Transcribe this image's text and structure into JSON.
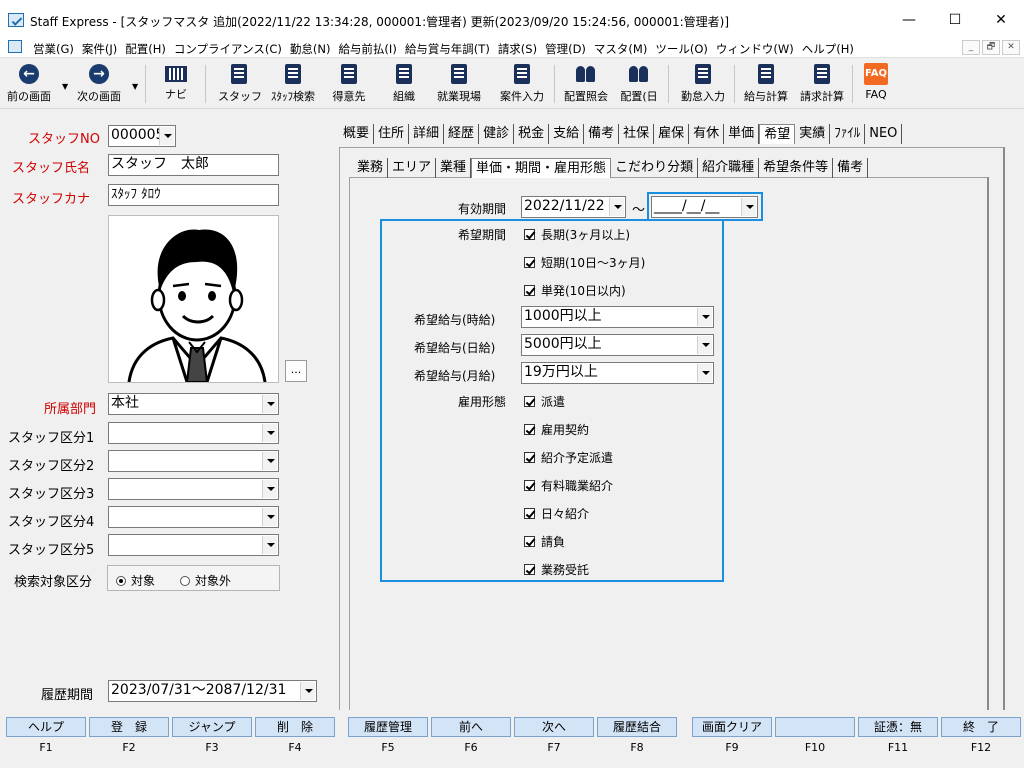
{
  "window": {
    "title": "Staff Express - [スタッフマスタ 追加(2022/11/22 13:34:28, 000001:管理者) 更新(2023/09/20 15:24:56, 000001:管理者)]",
    "min": "—",
    "max": "☐",
    "close": "✕"
  },
  "menu": [
    "営業(G)",
    "案件(J)",
    "配置(H)",
    "コンプライアンス(C)",
    "勤怠(N)",
    "給与前払(I)",
    "給与賞与年調(T)",
    "請求(S)",
    "管理(D)",
    "マスタ(M)",
    "ツール(O)",
    "ウィンドウ(W)",
    "ヘルプ(H)"
  ],
  "mdi": [
    "_",
    "🗗",
    "✕"
  ],
  "toolbar": {
    "prev": "前の画面",
    "next": "次の画面",
    "navi": "ナビ",
    "staff": "スタッフ",
    "staff_search": "ｽﾀｯﾌ検索",
    "client": "得意先",
    "org": "組織",
    "site": "就業現場",
    "job_entry": "案件入力",
    "assign_view": "配置照会",
    "assign_day": "配置(日",
    "attendance": "勤怠入力",
    "payroll": "給与計算",
    "billing": "請求計算",
    "faq": "FAQ"
  },
  "staff": {
    "no_label": "スタッフNO",
    "no_value": "000005",
    "name_label": "スタッフ氏名",
    "name_value": "スタッフ　太郎",
    "kana_label": "スタッフカナ",
    "kana_value": "ｽﾀｯﾌ ﾀﾛｳ",
    "browse": "...",
    "dept_label": "所属部門",
    "dept_value": "本社",
    "cat1": "スタッフ区分1",
    "cat2": "スタッフ区分2",
    "cat3": "スタッフ区分3",
    "cat4": "スタッフ区分4",
    "cat5": "スタッフ区分5",
    "search_label": "検索対象区分",
    "search_on": "対象",
    "search_off": "対象外",
    "history_label": "履歴期間",
    "history_value": "2023/07/31～2087/12/31"
  },
  "tabs": [
    "概要",
    "住所",
    "詳細",
    "経歴",
    "健診",
    "税金",
    "支給",
    "備考",
    "社保",
    "雇保",
    "有休",
    "単価",
    "希望",
    "実績",
    "ﾌｧｲﾙ",
    "NEO"
  ],
  "active_tab": "希望",
  "subtabs": [
    "業務",
    "エリア",
    "業種",
    "単価・期間・雇用形態",
    "こだわり分類",
    "紹介職種",
    "希望条件等",
    "備考"
  ],
  "active_subtab": "単価・期間・雇用形態",
  "form": {
    "valid_label": "有効期間",
    "valid_from": "2022/11/22",
    "tilde": "～",
    "valid_to": "____/__/__",
    "period_label": "希望期間",
    "period_long": "長期(3ヶ月以上)",
    "period_short": "短期(10日～3ヶ月)",
    "period_single": "単発(10日以内)",
    "pay_hour_label": "希望給与(時給)",
    "pay_hour": "1000円以上",
    "pay_day_label": "希望給与(日給)",
    "pay_day": "5000円以上",
    "pay_month_label": "希望給与(月給)",
    "pay_month": "19万円以上",
    "emp_label": "雇用形態",
    "emp": [
      "派遣",
      "雇用契約",
      "紹介予定派遣",
      "有料職業紹介",
      "日々紹介",
      "請負",
      "業務受託"
    ]
  },
  "fkeys": [
    {
      "label": "ヘルプ",
      "key": "F1"
    },
    {
      "label": "登　録",
      "key": "F2"
    },
    {
      "label": "ジャンプ",
      "key": "F3"
    },
    {
      "label": "削　除",
      "key": "F4"
    },
    {
      "label": "履歴管理",
      "key": "F5"
    },
    {
      "label": "前へ",
      "key": "F6"
    },
    {
      "label": "次へ",
      "key": "F7"
    },
    {
      "label": "履歴結合",
      "key": "F8"
    },
    {
      "label": "画面クリア",
      "key": "F9"
    },
    {
      "label": "",
      "key": "F10"
    },
    {
      "label": "証憑：無",
      "key": "F11"
    },
    {
      "label": "終　了",
      "key": "F12"
    }
  ],
  "colors": {
    "required_label": "#d00000",
    "highlight": "#1a8fe0",
    "fkey_bg": "#d4e4f7"
  }
}
